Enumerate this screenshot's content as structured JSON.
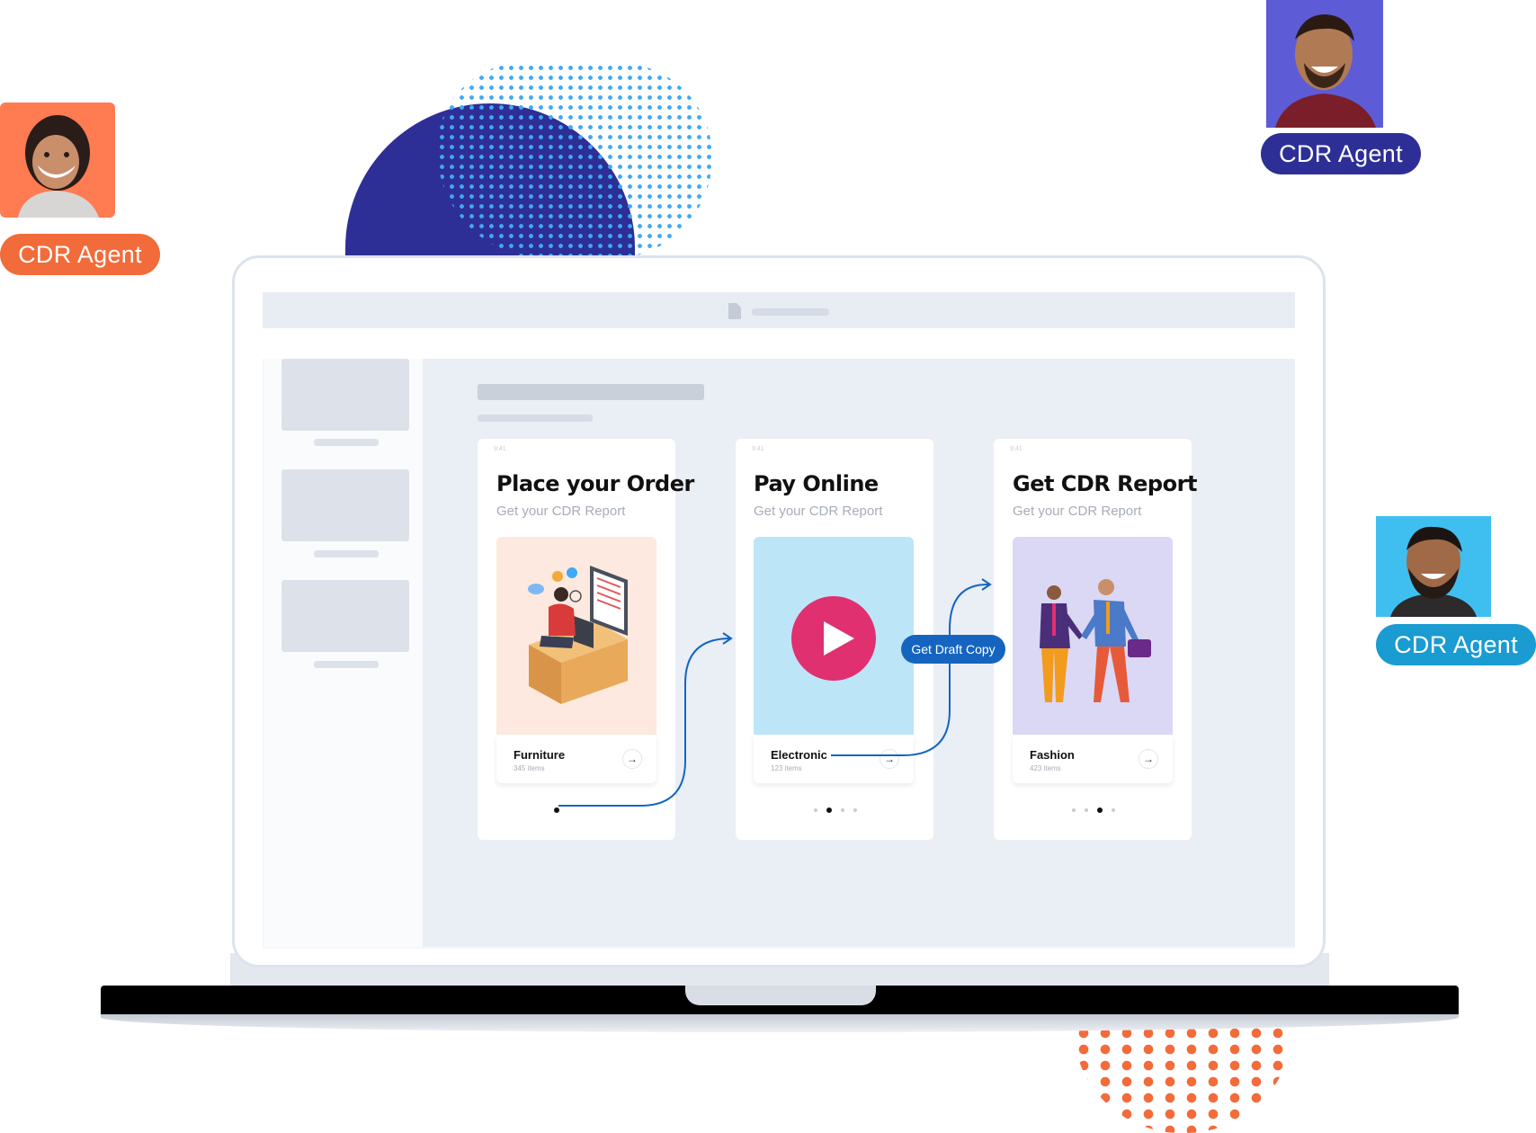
{
  "agents": [
    {
      "label": "CDR Agent",
      "color": "#f26b3a",
      "photo_bg": "#ff7b52"
    },
    {
      "label": "CDR Agent",
      "color": "#2d2f96",
      "photo_bg": "#5e5bd6"
    },
    {
      "label": "CDR Agent",
      "color": "#1a9bd1",
      "photo_bg": "#3fbff0"
    }
  ],
  "icons": {
    "document": "document-icon",
    "play": "play-icon",
    "arrow": "arrow-right-icon"
  },
  "cards": [
    {
      "status_time": "9:41",
      "title": "Place your Order",
      "subtitle": "Get your CDR Report",
      "tile_bg": "#fde9df",
      "category": "Furniture",
      "count": "345 items",
      "active_dot": 0
    },
    {
      "status_time": "9:41",
      "title": "Pay Online",
      "subtitle": "Get your CDR Report",
      "tile_bg": "#bde5f8",
      "category": "Electronic",
      "count": "123 items",
      "active_dot": 1
    },
    {
      "status_time": "9:41",
      "title": "Get CDR Report",
      "subtitle": "Get your CDR Report",
      "tile_bg": "#dad8f4",
      "category": "Fashion",
      "count": "423 items",
      "active_dot": 2
    }
  ],
  "draft_button": {
    "label": "Get Draft Copy",
    "color": "#1565c0"
  },
  "colors": {
    "play_button": "#e0306f",
    "flow_line": "#1565c0"
  }
}
